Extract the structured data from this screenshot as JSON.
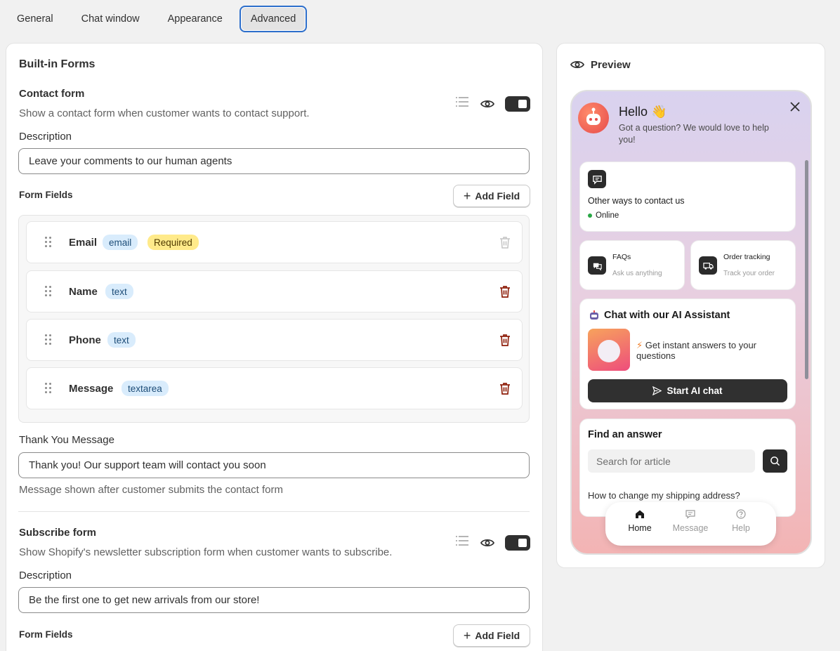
{
  "tabs": [
    {
      "label": "General"
    },
    {
      "label": "Chat window"
    },
    {
      "label": "Appearance"
    },
    {
      "label": "Advanced"
    }
  ],
  "built_in_forms": {
    "title": "Built-in Forms",
    "contact_form": {
      "name": "Contact form",
      "description_text": "Show a contact form when customer wants to contact support.",
      "description_label": "Description",
      "description_value": "Leave your comments to our human agents",
      "form_fields_label": "Form Fields",
      "add_field_label": "Add Field",
      "fields": [
        {
          "name": "Email",
          "type": "email",
          "required": "Required"
        },
        {
          "name": "Name",
          "type": "text"
        },
        {
          "name": "Phone",
          "type": "text"
        },
        {
          "name": "Message",
          "type": "textarea"
        }
      ],
      "thank_you_label": "Thank You Message",
      "thank_you_value": "Thank you! Our support team will contact you soon",
      "thank_you_help": "Message shown after customer submits the contact form"
    },
    "subscribe_form": {
      "name": "Subscribe form",
      "description_text": "Show Shopify's newsletter subscription form when customer wants to subscribe.",
      "description_label": "Description",
      "description_value": "Be the first one to get new arrivals from our store!",
      "form_fields_label": "Form Fields",
      "add_field_label": "Add Field"
    }
  },
  "preview": {
    "title": "Preview",
    "hello": "Hello 👋",
    "tagline": "Got a question? We would love to help you!",
    "contact_card": {
      "title": "Other ways to contact us",
      "status": "Online"
    },
    "faqs": {
      "title": "FAQs",
      "subtitle": "Ask us anything"
    },
    "order_tracking": {
      "title": "Order tracking",
      "subtitle": "Track your order"
    },
    "ai_card": {
      "title": "Chat with our AI Assistant",
      "text": "Get instant answers to your questions",
      "button": "Start AI chat"
    },
    "find_answer": {
      "title": "Find an answer",
      "placeholder": "Search for article",
      "cut_text": "How to change my shipping address?"
    },
    "nav": [
      {
        "label": "Home"
      },
      {
        "label": "Message"
      },
      {
        "label": "Help"
      }
    ]
  },
  "colors": {
    "accent_focus": "#2c6ecb",
    "delete_red": "#8e1f0b",
    "type_badge": "#d9ecfc",
    "required_badge": "#ffea8a"
  }
}
